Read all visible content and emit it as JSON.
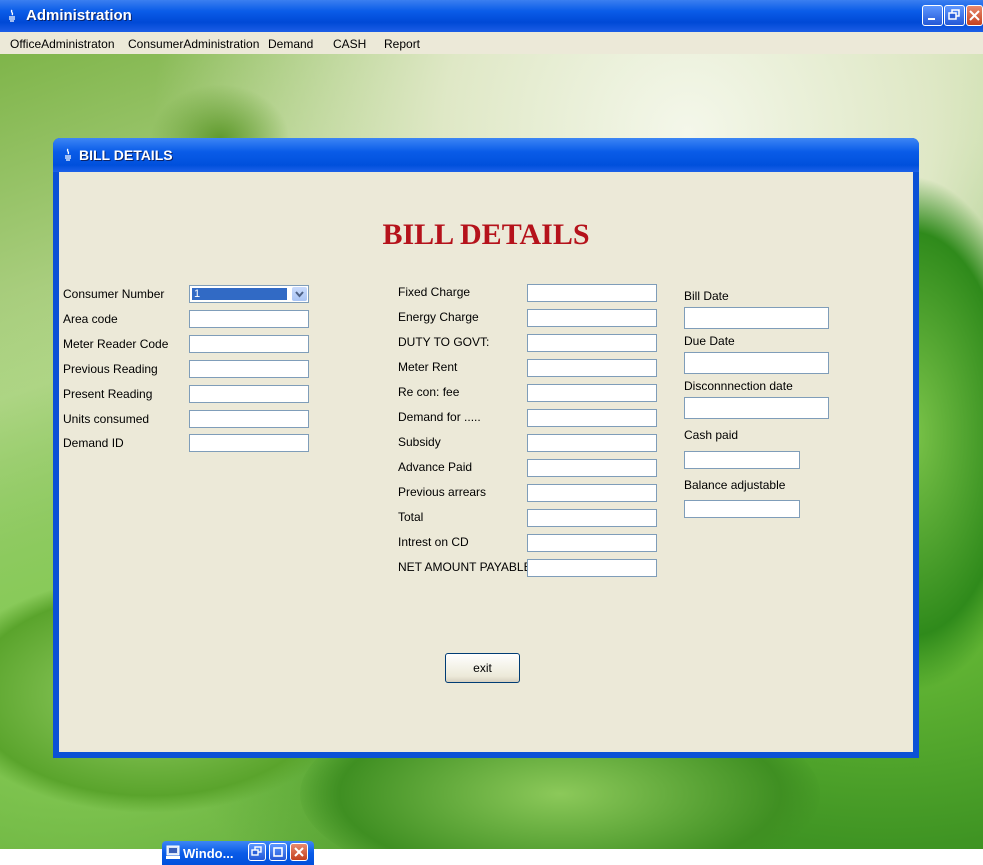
{
  "window": {
    "title": "Administration"
  },
  "menu": [
    "OfficeAdministraton",
    "ConsumerAdministration",
    "Demand",
    "CASH",
    "Report"
  ],
  "dialog": {
    "title": "BILL DETAILS",
    "heading": "BILL DETAILS",
    "left_fields": [
      {
        "label": "Consumer Number",
        "value": "1"
      },
      {
        "label": "Area code",
        "value": ""
      },
      {
        "label": "Meter Reader Code",
        "value": ""
      },
      {
        "label": "Previous Reading",
        "value": ""
      },
      {
        "label": "Present Reading",
        "value": ""
      },
      {
        "label": "Units consumed",
        "value": ""
      },
      {
        "label": "Demand ID",
        "value": ""
      }
    ],
    "middle_fields": [
      {
        "label": "Fixed Charge",
        "value": ""
      },
      {
        "label": "Energy Charge",
        "value": ""
      },
      {
        "label": "DUTY TO GOVT:",
        "value": ""
      },
      {
        "label": "Meter Rent",
        "value": ""
      },
      {
        "label": "Re con: fee",
        "value": ""
      },
      {
        "label": "Demand for .....",
        "value": ""
      },
      {
        "label": "Subsidy",
        "value": ""
      },
      {
        "label": "Advance Paid",
        "value": ""
      },
      {
        "label": "Previous arrears",
        "value": ""
      },
      {
        "label": "Total",
        "value": ""
      },
      {
        "label": "Intrest on CD",
        "value": ""
      },
      {
        "label": "NET AMOUNT PAYABLE",
        "value": ""
      }
    ],
    "right_fields": [
      {
        "label": "Bill Date",
        "value": ""
      },
      {
        "label": "Due Date",
        "value": ""
      },
      {
        "label": "Disconnnection date",
        "value": ""
      },
      {
        "label": "Cash paid",
        "value": ""
      },
      {
        "label": "Balance adjustable",
        "value": ""
      }
    ],
    "exit_label": "exit"
  },
  "minimized_window": {
    "title": "Windo..."
  },
  "colors": {
    "heading": "#b5121b",
    "titlebar": "#0a5ce8",
    "dialog_bg": "#ece9d8"
  }
}
